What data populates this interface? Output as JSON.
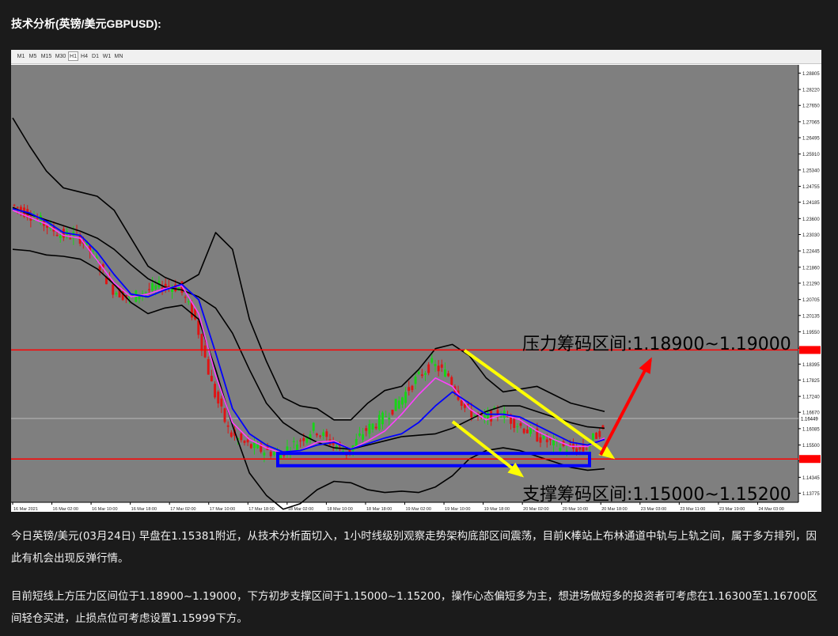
{
  "title": "技术分析(英镑/美元GBPUSD):",
  "toolbar": {
    "timeframes": [
      "M1",
      "M5",
      "M15",
      "M30",
      "H1",
      "H4",
      "D1",
      "W1",
      "MN"
    ],
    "active": "H1"
  },
  "chart_data": {
    "type": "candlestick",
    "symbol": "GBPUSD",
    "timeframe": "H1",
    "ylim": [
      1.1345,
      1.291
    ],
    "y_ticks": [
      "1.28805",
      "1.28220",
      "1.27650",
      "1.27065",
      "1.26495",
      "1.25910",
      "1.25340",
      "1.24755",
      "1.24185",
      "1.23600",
      "1.23030",
      "1.22445",
      "1.21860",
      "1.21290",
      "1.20705",
      "1.20135",
      "1.19550",
      "1.18965",
      "1.18395",
      "1.17825",
      "1.17240",
      "1.16670",
      "1.16085",
      "1.15500",
      "1.14930",
      "1.14345",
      "1.13775"
    ],
    "price_box": "1.16449",
    "res_box": "1.19000",
    "sup_box": "1.15000",
    "x_ticks": [
      "16 Mar 2021",
      "16 Mar 02:00",
      "16 Mar 10:00",
      "16 Mar 18:00",
      "17 Mar 02:00",
      "17 Mar 10:00",
      "17 Mar 18:00",
      "18 Mar 02:00",
      "18 Mar 10:00",
      "18 Mar 18:00",
      "19 Mar 02:00",
      "19 Mar 10:00",
      "19 Mar 18:00",
      "20 Mar 02:00",
      "20 Mar 10:00",
      "20 Mar 18:00",
      "23 Mar 03:00",
      "23 Mar 11:00",
      "23 Mar 19:00",
      "24 Mar 03:00"
    ],
    "resistance": [
      1.189,
      1.19
    ],
    "support": [
      1.15,
      1.152
    ],
    "label_resistance": "压力筹码区间:1.18900~1.19000",
    "label_support": "支撑筹码区间:1.15000~1.15200",
    "bollinger_mid": [
      1.24,
      1.2375,
      1.2355,
      1.2335,
      1.2315,
      1.229,
      1.225,
      1.2195,
      1.2145,
      1.2115,
      1.2105,
      1.208,
      1.204,
      1.195,
      1.182,
      1.17,
      1.163,
      1.159,
      1.156,
      1.154,
      1.1535,
      1.155,
      1.1565,
      1.158,
      1.1585,
      1.159,
      1.161,
      1.164,
      1.167,
      1.169,
      1.169,
      1.167,
      1.165,
      1.163,
      1.1615,
      1.161
    ],
    "bollinger_up": [
      1.272,
      1.262,
      1.253,
      1.247,
      1.2455,
      1.244,
      1.239,
      1.229,
      1.219,
      1.215,
      1.2125,
      1.216,
      1.231,
      1.225,
      1.2,
      1.185,
      1.172,
      1.169,
      1.168,
      1.164,
      1.164,
      1.17,
      1.1745,
      1.176,
      1.182,
      1.1895,
      1.191,
      1.187,
      1.179,
      1.174,
      1.175,
      1.176,
      1.173,
      1.17,
      1.1685,
      1.167
    ],
    "bollinger_dn": [
      1.225,
      1.2245,
      1.223,
      1.2225,
      1.2215,
      1.218,
      1.2125,
      1.206,
      1.202,
      1.204,
      1.205,
      1.2,
      1.182,
      1.162,
      1.145,
      1.137,
      1.132,
      1.134,
      1.139,
      1.142,
      1.1415,
      1.139,
      1.138,
      1.1385,
      1.138,
      1.14,
      1.144,
      1.15,
      1.153,
      1.154,
      1.153,
      1.151,
      1.149,
      1.147,
      1.146,
      1.1465
    ],
    "ma_blue": [
      1.2395,
      1.238,
      1.235,
      1.231,
      1.23,
      1.224,
      1.216,
      1.209,
      1.208,
      1.2105,
      1.2125,
      1.207,
      1.188,
      1.168,
      1.159,
      1.155,
      1.1525,
      1.153,
      1.155,
      1.156,
      1.1535,
      1.1555,
      1.1575,
      1.159,
      1.163,
      1.169,
      1.174,
      1.17,
      1.166,
      1.166,
      1.165,
      1.162,
      1.159,
      1.156,
      1.155,
      1.157
    ],
    "ma_magenta": [
      1.239,
      1.2365,
      1.234,
      1.23,
      1.229,
      1.221,
      1.213,
      1.208,
      1.209,
      1.211,
      1.212,
      1.202,
      1.18,
      1.163,
      1.157,
      1.154,
      1.152,
      1.153,
      1.156,
      1.1565,
      1.1535,
      1.1565,
      1.16,
      1.166,
      1.173,
      1.179,
      1.176,
      1.168,
      1.164,
      1.166,
      1.164,
      1.16,
      1.157,
      1.1545,
      1.1545,
      1.1575
    ],
    "close_path": [
      1.241,
      1.238,
      1.234,
      1.23,
      1.23,
      1.222,
      1.211,
      1.2075,
      1.21,
      1.212,
      1.2115,
      1.199,
      1.175,
      1.159,
      1.155,
      1.153,
      1.152,
      1.156,
      1.161,
      1.156,
      1.152,
      1.16,
      1.164,
      1.17,
      1.178,
      1.184,
      1.18,
      1.168,
      1.164,
      1.167,
      1.163,
      1.159,
      1.156,
      1.154,
      1.153,
      1.16
    ]
  },
  "paragraph1": "今日英镑/美元(03月24日) 早盘在1.15381附近，从技术分析面切入，1小时线级别观察走势架构底部区间震荡，目前K棒站上布林通道中轨与上轨之间，属于多方排列，因此有机会出现反弹行情。",
  "paragraph2": "目前短线上方压力区间位于1.18900~1.19000，下方初步支撑区间于1.15000~1.15200，操作心态偏短多为主，想进场做短多的投资者可考虑在1.16300至1.16700区间轻仓买进，止损点位可考虑设置1.15999下方。"
}
